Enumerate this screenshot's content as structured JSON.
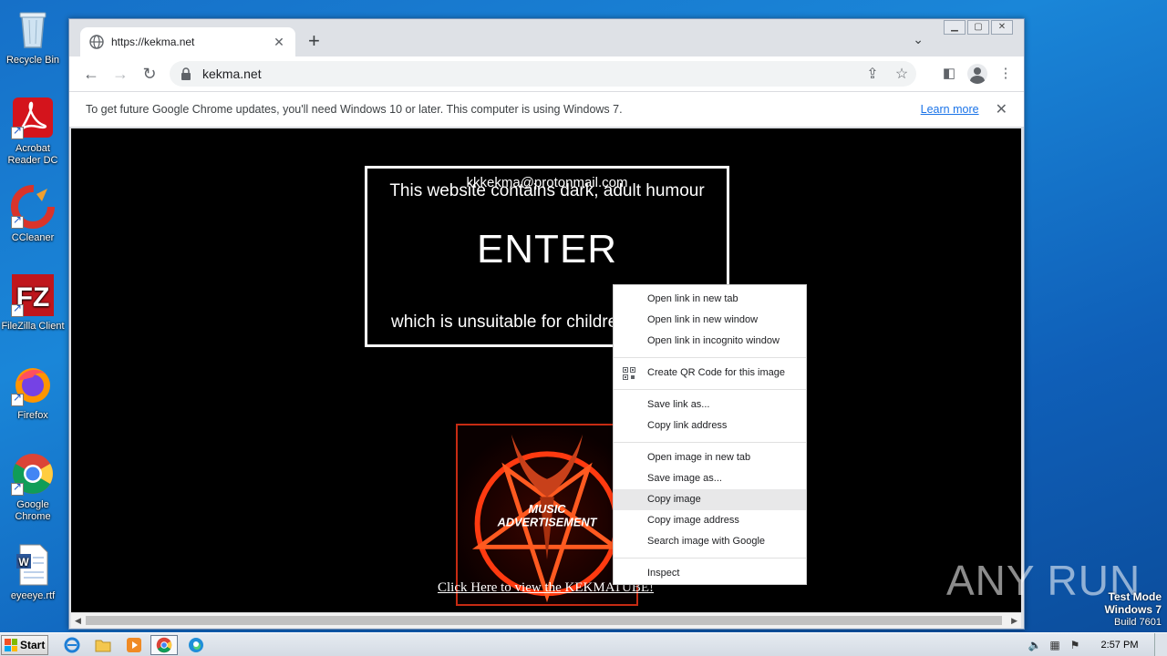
{
  "desktop": {
    "icons": [
      {
        "label": "Recycle Bin"
      },
      {
        "label": "Acrobat Reader DC"
      },
      {
        "label": "CCleaner"
      },
      {
        "label": "FileZilla Client"
      },
      {
        "label": "Firefox"
      },
      {
        "label": "Google Chrome"
      },
      {
        "label": "eyeeye.rtf"
      }
    ]
  },
  "browser": {
    "tab": {
      "title": "https://kekma.net"
    },
    "omnibox": {
      "url": "kekma.net"
    },
    "infobar": {
      "message": "To get future Google Chrome updates, you'll need Windows 10 or later. This computer is using Windows 7.",
      "link": "Learn more"
    }
  },
  "page": {
    "email": "kkkekma@protonmail.com",
    "line1": "This website contains dark, adult humour",
    "enter": "ENTER",
    "line3": "which is unsuitable for children",
    "advert": {
      "line1": "MUSIC",
      "line2": "ADVERTISEMENT"
    },
    "link": "Click Here to view the KEKMATUBE!"
  },
  "context_menu": {
    "items": [
      "Open link in new tab",
      "Open link in new window",
      "Open link in incognito window",
      "Create QR Code for this image",
      "Save link as...",
      "Copy link address",
      "Open image in new tab",
      "Save image as...",
      "Copy image",
      "Copy image address",
      "Search image with Google",
      "Inspect"
    ],
    "highlighted": "Copy image"
  },
  "watermark": {
    "text": "ANY RUN"
  },
  "os_info": {
    "line1": "Test Mode",
    "line2": "Windows 7",
    "line3": "Build 7601"
  },
  "taskbar": {
    "start_label": "Start",
    "clock": "2:57 PM"
  }
}
